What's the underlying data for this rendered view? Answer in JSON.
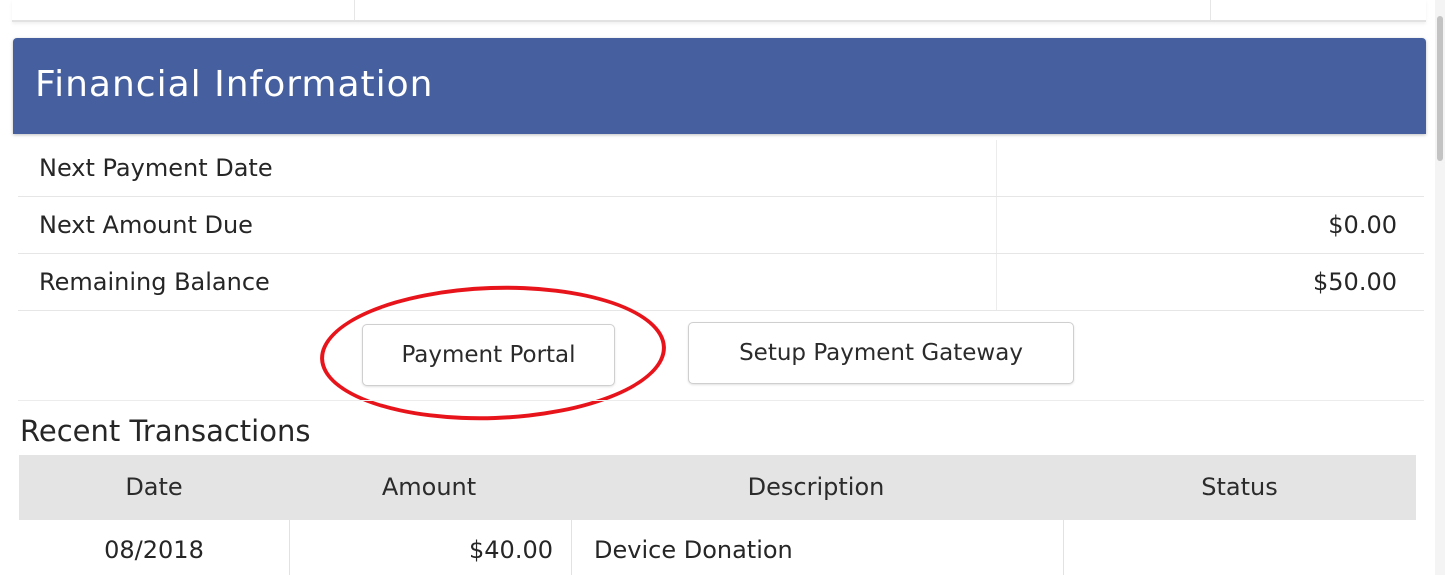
{
  "panel": {
    "title": "Financial Information",
    "header_color": "#465f9e"
  },
  "info_rows": [
    {
      "label": "Next Payment Date",
      "value": ""
    },
    {
      "label": "Next Amount Due",
      "value": "$0.00"
    },
    {
      "label": "Remaining Balance",
      "value": "$50.00"
    }
  ],
  "buttons": {
    "payment_portal": "Payment Portal",
    "setup_gateway": "Setup Payment Gateway"
  },
  "annotation": {
    "highlight_color": "#e8141b",
    "highlights": "payment_portal"
  },
  "transactions": {
    "title": "Recent Transactions",
    "columns": [
      "Date",
      "Amount",
      "Description",
      "Status"
    ],
    "rows": [
      {
        "date": "08/2018",
        "amount": "$40.00",
        "description": "Device Donation",
        "status": ""
      }
    ]
  }
}
